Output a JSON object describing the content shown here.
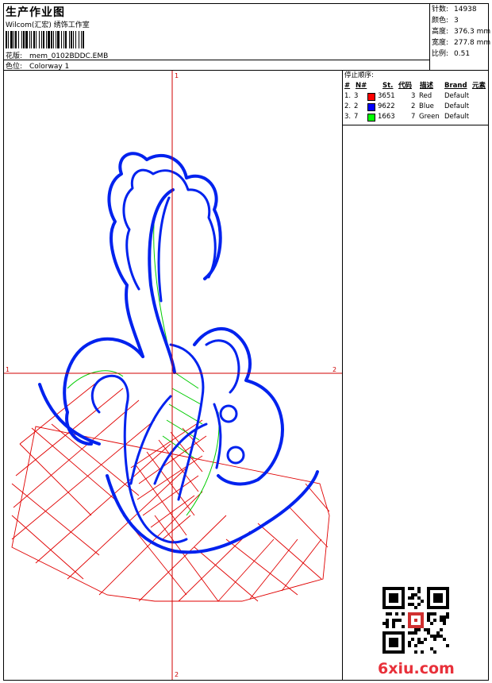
{
  "header": {
    "title": "生产作业图",
    "subtitle": "Wilcom(汇宏) 绣饰工作室",
    "design_label": "花版:",
    "design_value": "mem_0102BDDC.EMB",
    "colorway_label": "色位:",
    "colorway_value": "Colorway 1"
  },
  "stats": {
    "stitches_label": "针数:",
    "stitches_value": "14938",
    "colors_label": "颜色:",
    "colors_value": "3",
    "height_label": "高度:",
    "height_value": "376.3 mm",
    "width_label": "宽度:",
    "width_value": "277.8 mm",
    "scale_label": "比例:",
    "scale_value": "0.51"
  },
  "stop_sequence": {
    "title": "停止顺序:",
    "headers": [
      "#",
      "N#",
      "St.",
      "代码",
      "描述",
      "Brand",
      "元素"
    ],
    "rows": [
      {
        "no": "1.",
        "needle": "3",
        "color": "#ff0000",
        "stitches": "3651",
        "code": "3",
        "desc": "Red",
        "brand": "Default"
      },
      {
        "no": "2.",
        "needle": "2",
        "color": "#0000ff",
        "stitches": "9622",
        "code": "2",
        "desc": "Blue",
        "brand": "Default"
      },
      {
        "no": "3.",
        "needle": "7",
        "color": "#00ff00",
        "stitches": "1663",
        "code": "7",
        "desc": "Green",
        "brand": "Default"
      }
    ]
  },
  "axes": {
    "top_label": "1",
    "bottom_label": "2",
    "left_label": "1",
    "right_label": "2"
  },
  "watermark": "6xiu.com",
  "colors": {
    "red": "#e00000",
    "blue": "#0022ee",
    "green": "#00cc00",
    "axis": "#d00000"
  }
}
